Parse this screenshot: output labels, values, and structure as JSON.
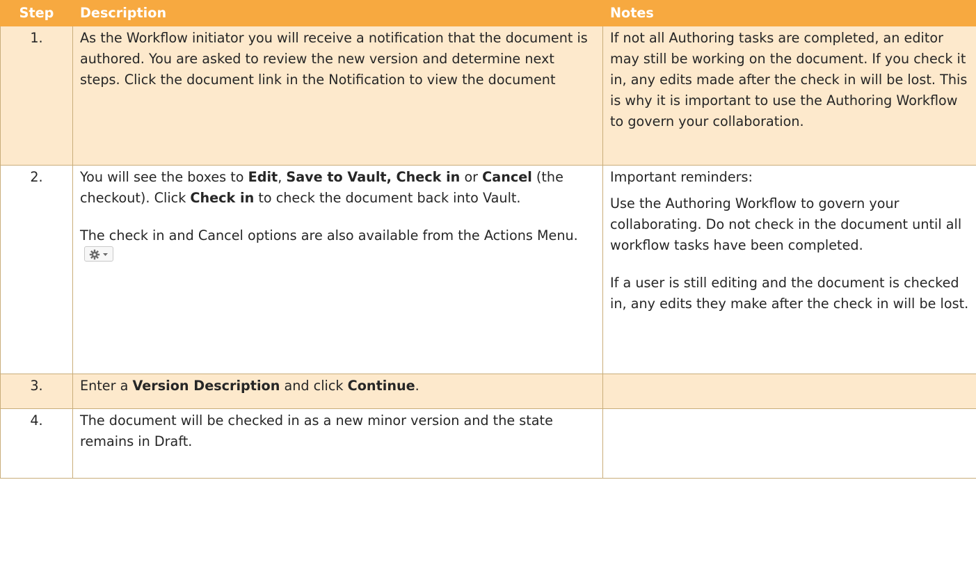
{
  "header": {
    "step": "Step",
    "description": "Description",
    "notes": "Notes"
  },
  "rows": [
    {
      "step": "1.",
      "description": "As the Workflow initiator you will receive a notification that the document is authored. You are asked to review the new version and determine next steps.  Click the document link in the Notification to view the document",
      "notes": "If not all Authoring tasks are completed, an editor may still be working on the document. If you check it in, any edits made after the check in will be lost. This is why it is important to use the Authoring Workflow to govern your collaboration."
    },
    {
      "step": "2.",
      "desc_p1": {
        "t1": "You will see the boxes to ",
        "b1": "Edit",
        "t2": ", ",
        "b2": "Save to Vault, Check in",
        "t3": " or ",
        "b3": "Cancel",
        "t4": " (the checkout). Click ",
        "b4": "Check in",
        "t5": " to check the document back into Vault."
      },
      "desc_p2": "The check in and Cancel options are also available from the Actions Menu.",
      "actions_icon": "gear-dropdown-icon",
      "notes_p1": "Important reminders:",
      "notes_p2": "Use the Authoring Workflow to govern your collaborating. Do not check in the document until all workflow tasks have been completed.",
      "notes_p3": "If a user is still editing and the document is checked in, any edits they make after the check in will be lost."
    },
    {
      "step": "3.",
      "desc": {
        "t1": "Enter a ",
        "b1": "Version Description",
        "t2": " and click ",
        "b2": "Continue",
        "t3": "."
      },
      "notes": ""
    },
    {
      "step": "4.",
      "description": "The document will be checked in as a new minor version and the state remains in Draft.",
      "notes": ""
    }
  ],
  "colors": {
    "header_bg": "#f7a940",
    "shaded_row": "#fde9cc",
    "border": "#c9ad7a"
  }
}
